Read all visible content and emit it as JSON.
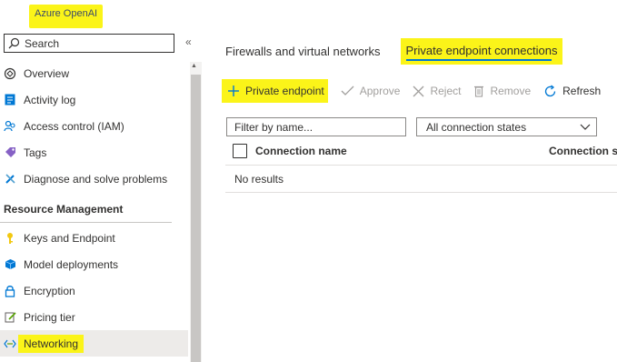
{
  "app": {
    "title": "Azure OpenAI"
  },
  "sidebar": {
    "search_label": "Search",
    "collapse_glyph": "«",
    "items": [
      {
        "label": "Overview",
        "icon": "openai-icon"
      },
      {
        "label": "Activity log",
        "icon": "activity-log-icon"
      },
      {
        "label": "Access control (IAM)",
        "icon": "people-icon"
      },
      {
        "label": "Tags",
        "icon": "tag-icon"
      },
      {
        "label": "Diagnose and solve problems",
        "icon": "wrench-icon"
      }
    ],
    "section_title": "Resource Management",
    "section_items": [
      {
        "label": "Keys and Endpoint",
        "icon": "key-icon"
      },
      {
        "label": "Model deployments",
        "icon": "cube-icon"
      },
      {
        "label": "Encryption",
        "icon": "lock-icon"
      },
      {
        "label": "Pricing tier",
        "icon": "edit-icon"
      },
      {
        "label": "Networking",
        "icon": "networking-icon",
        "active": true
      }
    ]
  },
  "tabs": [
    {
      "label": "Firewalls and virtual networks"
    },
    {
      "label": "Private endpoint connections",
      "active": true
    }
  ],
  "toolbar": {
    "add_label": "Private endpoint",
    "approve_label": "Approve",
    "reject_label": "Reject",
    "remove_label": "Remove",
    "refresh_label": "Refresh"
  },
  "filter": {
    "placeholder": "Filter by name..."
  },
  "state_dropdown": {
    "selected": "All connection states"
  },
  "table": {
    "columns": [
      "Connection name",
      "Connection state"
    ],
    "empty_text": "No results"
  },
  "colors": {
    "highlight": "#fbf419",
    "accent": "#0078d4"
  }
}
